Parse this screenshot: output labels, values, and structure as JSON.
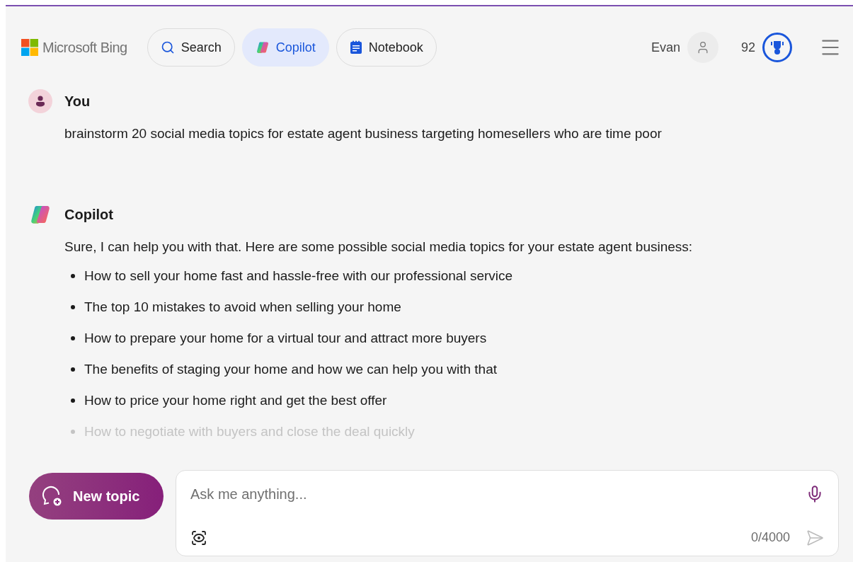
{
  "header": {
    "brand": "Microsoft Bing",
    "tabs": [
      {
        "label": "Search",
        "kind": "search",
        "selected": false
      },
      {
        "label": "Copilot",
        "kind": "copilot",
        "selected": true
      },
      {
        "label": "Notebook",
        "kind": "notebook",
        "selected": false
      }
    ],
    "user": "Evan",
    "points": "92"
  },
  "messages": [
    {
      "kind": "user",
      "author": "You",
      "text": "brainstorm 20 social media topics for estate agent business targeting homesellers who are time poor"
    },
    {
      "kind": "copilot",
      "author": "Copilot",
      "text": "Sure, I can help you with that. Here are some possible social media topics for your estate agent business:",
      "items": [
        {
          "text": "How to sell your home fast and hassle-free with our professional service",
          "faded": false
        },
        {
          "text": "The top 10 mistakes to avoid when selling your home",
          "faded": false
        },
        {
          "text": "How to prepare your home for a virtual tour and attract more buyers",
          "faded": false
        },
        {
          "text": "The benefits of staging your home and how we can help you with that",
          "faded": false
        },
        {
          "text": "How to price your home right and get the best offer",
          "faded": false
        },
        {
          "text": "How to negotiate with buyers and close the deal quickly",
          "faded": true
        }
      ]
    }
  ],
  "composer": {
    "new_topic": "New topic",
    "placeholder": "Ask me anything...",
    "counter": "0/4000"
  }
}
